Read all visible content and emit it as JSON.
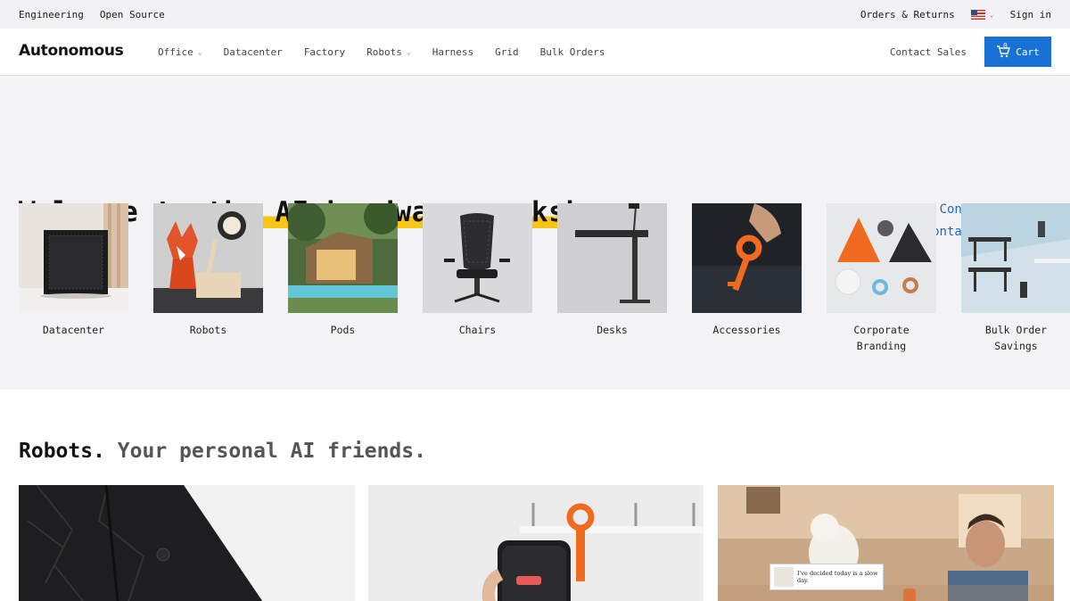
{
  "utility": {
    "left_links": [
      "Engineering",
      "Open Source"
    ],
    "orders_returns": "Orders & Returns",
    "sign_in": "Sign in"
  },
  "nav": {
    "logo": "Autonomous",
    "items": [
      {
        "label": "Office",
        "dropdown": true
      },
      {
        "label": "Datacenter",
        "dropdown": false
      },
      {
        "label": "Factory",
        "dropdown": false
      },
      {
        "label": "Robots",
        "dropdown": true
      },
      {
        "label": "Harness",
        "dropdown": false
      },
      {
        "label": "Grid",
        "dropdown": false
      },
      {
        "label": "Bulk Orders",
        "dropdown": false
      }
    ],
    "contact_sales": "Contact Sales",
    "cart_label": "Cart",
    "cart_count": "0"
  },
  "hero": {
    "headline_pre": "Welcome to ",
    "headline_highlight": "the AI hardware workshop",
    "headline_post": ".",
    "contact_sales_link": "Contact sales →",
    "contact_support_link": "Contact support →"
  },
  "categories": [
    {
      "label": "Datacenter",
      "icon": "server-rack-image"
    },
    {
      "label": "Robots",
      "icon": "fox-robot-image"
    },
    {
      "label": "Pods",
      "icon": "backyard-pod-image"
    },
    {
      "label": "Chairs",
      "icon": "ergonomic-chair-image"
    },
    {
      "label": "Desks",
      "icon": "standing-desk-image"
    },
    {
      "label": "Accessories",
      "icon": "orange-key-image"
    },
    {
      "label": "Corporate\nBranding",
      "icon": "branded-objects-image"
    },
    {
      "label": "Bulk Order\nSavings",
      "icon": "office-desks-image"
    }
  ],
  "section": {
    "title": "Robots.",
    "subtitle": " Your personal AI friends.",
    "bear_bubble": "I've decided today is a slow day."
  },
  "colors": {
    "accent": "#1872d6",
    "highlight": "#f9c515",
    "link": "#1869c9",
    "hero_bg": "#f3f3f5"
  }
}
